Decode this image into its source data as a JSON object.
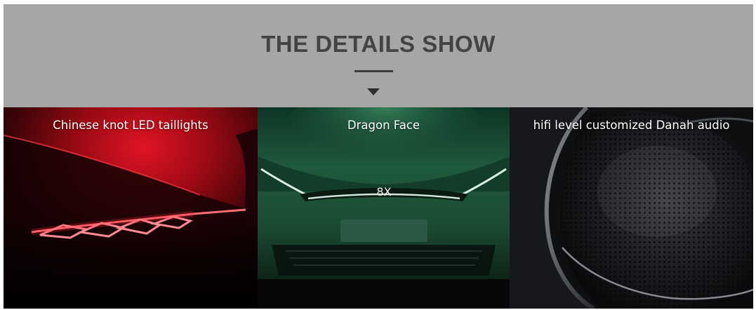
{
  "banner": {
    "title": "THE DETAILS SHOW",
    "background_color": "#a6a6a6",
    "arrow_icon": "triangle-down-icon"
  },
  "panels": [
    {
      "label": "Chinese knot LED taillights",
      "theme_color": "#c4121c"
    },
    {
      "label": "Dragon Face",
      "theme_color": "#1f5a3c"
    },
    {
      "label": "hifi level customized Danah audio",
      "theme_color": "#2a2c30"
    }
  ]
}
